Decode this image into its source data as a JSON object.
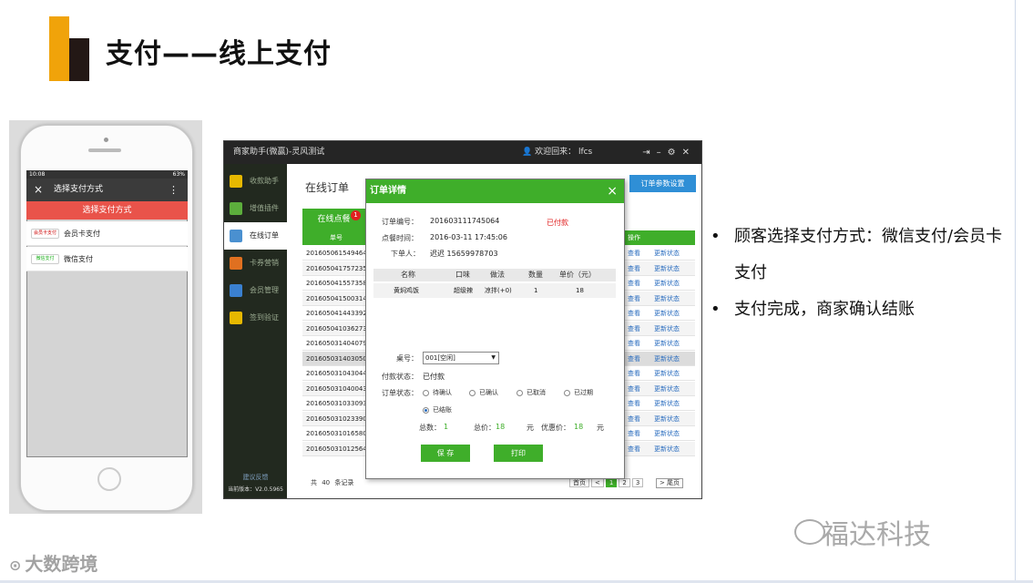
{
  "slide": {
    "title": "支付——线上支付",
    "bullets": [
      "顾客选择支付方式：微信支付/会员卡支付",
      "支付完成，商家确认结账"
    ]
  },
  "phone": {
    "status_time": "10:08",
    "status_battery": "63%",
    "header_title": "选择支付方式",
    "close_icon": "×",
    "menu_icon": "⋮",
    "primary_button": "选择支付方式",
    "options": [
      {
        "label": "会员卡支付",
        "icon": "member-card-pay-icon",
        "icon_text": "会员卡支付"
      },
      {
        "label": "微信支付",
        "icon": "wechat-pay-icon",
        "icon_text": "微信支付"
      }
    ]
  },
  "app": {
    "window_title": "商家助手(微赢)-灵风测试",
    "welcome": "欢迎回来： lfcs",
    "sidebar": [
      {
        "label": "收款助手",
        "icon": "cash-icon",
        "color": "#e6b800"
      },
      {
        "label": "增值插件",
        "icon": "puzzle-icon",
        "color": "#5cae3c"
      },
      {
        "label": "在线订单",
        "icon": "order-icon",
        "color": "#4a90d0",
        "active": true
      },
      {
        "label": "卡券营销",
        "icon": "coupon-icon",
        "color": "#e07020"
      },
      {
        "label": "会员管理",
        "icon": "member-icon",
        "color": "#3a80d0"
      },
      {
        "label": "签到验证",
        "icon": "checkin-icon",
        "color": "#e6b800"
      }
    ],
    "sidebar_footer_link": "建议反馈",
    "sidebar_version": "当前版本：V2.0.5965",
    "page_title": "在线订单",
    "settings_button": "订单参数设置",
    "tab_label": "在线点餐",
    "tab_badge": "1",
    "table_header": {
      "col_id": "单号",
      "col_ops": "操作"
    },
    "rows": [
      "201605061549464",
      "201605041757235",
      "201605041557358",
      "201605041500314",
      "201605041443392",
      "201605041036273",
      "201605031404079",
      "201605031403050",
      "201605031043044",
      "201605031040043",
      "201605031033093",
      "201605031023390",
      "201605031016580",
      "201605031012564"
    ],
    "op_view": "查看",
    "op_update": "更新状态",
    "total_text": "共 40 条记录",
    "pager": {
      "prev_text": "首页",
      "prev_icon": "<",
      "pages": [
        "1",
        "2",
        "3"
      ],
      "next_icon": ">",
      "last": "尾页"
    }
  },
  "dialog": {
    "title": "订单详情",
    "close_icon": "×",
    "order_no_label": "订单编号：",
    "order_no": "201603111745064",
    "paid_status": "已付款",
    "order_time_label": "点餐时间：",
    "order_time": "2016-03-11 17:45:06",
    "orderer_label": "下单人：",
    "orderer": "迟迟 15659978703",
    "item_headers": {
      "name": "名称",
      "taste": "口味",
      "method": "做法",
      "qty": "数量",
      "price": "单价（元）"
    },
    "items": [
      {
        "name": "黄焖鸡饭",
        "taste": "超级辣",
        "method": "凉拌(+0)",
        "qty": "1",
        "price": "18"
      }
    ],
    "table_label": "桌号：",
    "table_value": "001[空闲]",
    "pay_status_label": "付款状态：",
    "pay_status": "已付款",
    "order_status_label": "订单状态：",
    "statuses": [
      "待确认",
      "已确认",
      "已取消",
      "已过期",
      "已结账"
    ],
    "count_label": "总数：",
    "count": "1",
    "total_label": "总价：",
    "total": "18",
    "yuan": "元",
    "discount_label": "优惠价：",
    "discount": "18",
    "save_button": "保 存",
    "print_button": "打印"
  },
  "watermarks": {
    "left": "大数跨境",
    "right": "福达科技"
  }
}
